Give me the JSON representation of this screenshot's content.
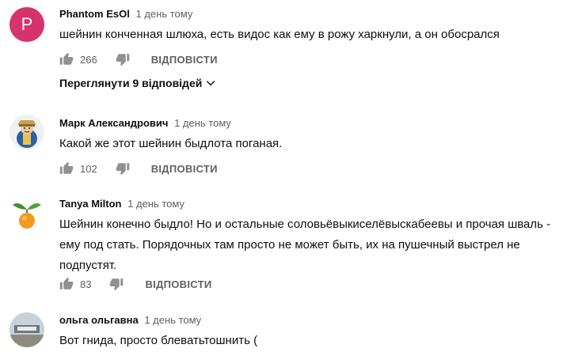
{
  "comments": [
    {
      "avatar_letter": "P",
      "author": "Phantom EsOl",
      "time": "1 день тому",
      "text": "шейнин конченная шлюха, есть видос как ему в рожу харкнули, а он обосрался",
      "likes": "266",
      "reply_label": "ВІДПОВІСТИ",
      "view_replies": "Переглянути 9 відповідей"
    },
    {
      "author": "Марк Александрович",
      "time": "1 день тому",
      "text": "Какой же этот шейнин быдлота поганая.",
      "likes": "102",
      "reply_label": "ВІДПОВІСТИ"
    },
    {
      "author": "Tanya Milton",
      "time": "1 день тому",
      "text_lines": [
        "Шейнин  конечно быдло! Но и остальные соловьёвыкиселёвыскабеевы и прочая шваль -",
        "ему под стать. Порядочных там просто не может быть, их на пушечный выстрел не",
        "подпустят."
      ],
      "likes": "83",
      "reply_label": "ВІДПОВІСТИ"
    },
    {
      "author": "ольга ольгавна",
      "time": "1 день тому",
      "text": "Вот гнида,  просто блеватьтошнить ("
    }
  ],
  "colors": {
    "avatar_p": "#d6336c",
    "icon": "#909090",
    "secondary_text": "#606060"
  },
  "icons": {
    "like": "thumb-up-icon",
    "dislike": "thumb-down-icon",
    "expand": "chevron-down-icon"
  }
}
